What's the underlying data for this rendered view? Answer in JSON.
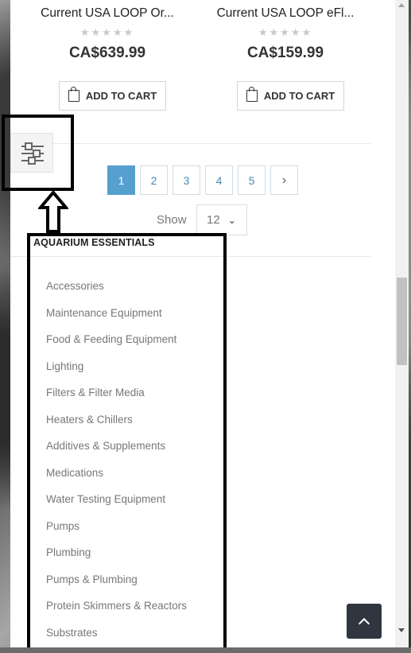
{
  "products": [
    {
      "name": "Current USA LOOP Or...",
      "stars": "★★★★★",
      "price": "CA$639.99",
      "cart_label": "ADD TO CART"
    },
    {
      "name": "Current USA LOOP eFl...",
      "stars": "★★★★★",
      "price": "CA$159.99",
      "cart_label": "ADD TO CART"
    }
  ],
  "pagination": {
    "pages": [
      "1",
      "2",
      "3",
      "4",
      "5"
    ],
    "active": "1",
    "next": "›"
  },
  "show": {
    "label": "Show",
    "value": "12",
    "chevron": "⌄"
  },
  "category": {
    "title": "AQUARIUM ESSENTIALS",
    "items": [
      "Accessories",
      "Maintenance Equipment",
      "Food & Feeding Equipment",
      "Lighting",
      "Filters & Filter Media",
      "Heaters & Chillers",
      "Additives & Supplements",
      "Medications",
      "Water Testing Equipment",
      "Pumps",
      "Plumbing",
      "Pumps & Plumbing",
      "Protein Skimmers & Reactors",
      "Substrates"
    ]
  },
  "icons": {
    "filter": "sliders-icon",
    "cart": "shopping-bag-icon",
    "back_to_top": "chevron-up-icon"
  },
  "colors": {
    "active_page": "#55a0cf",
    "page_link": "#4a8ab4",
    "back_to_top_bg": "#2f3640"
  }
}
